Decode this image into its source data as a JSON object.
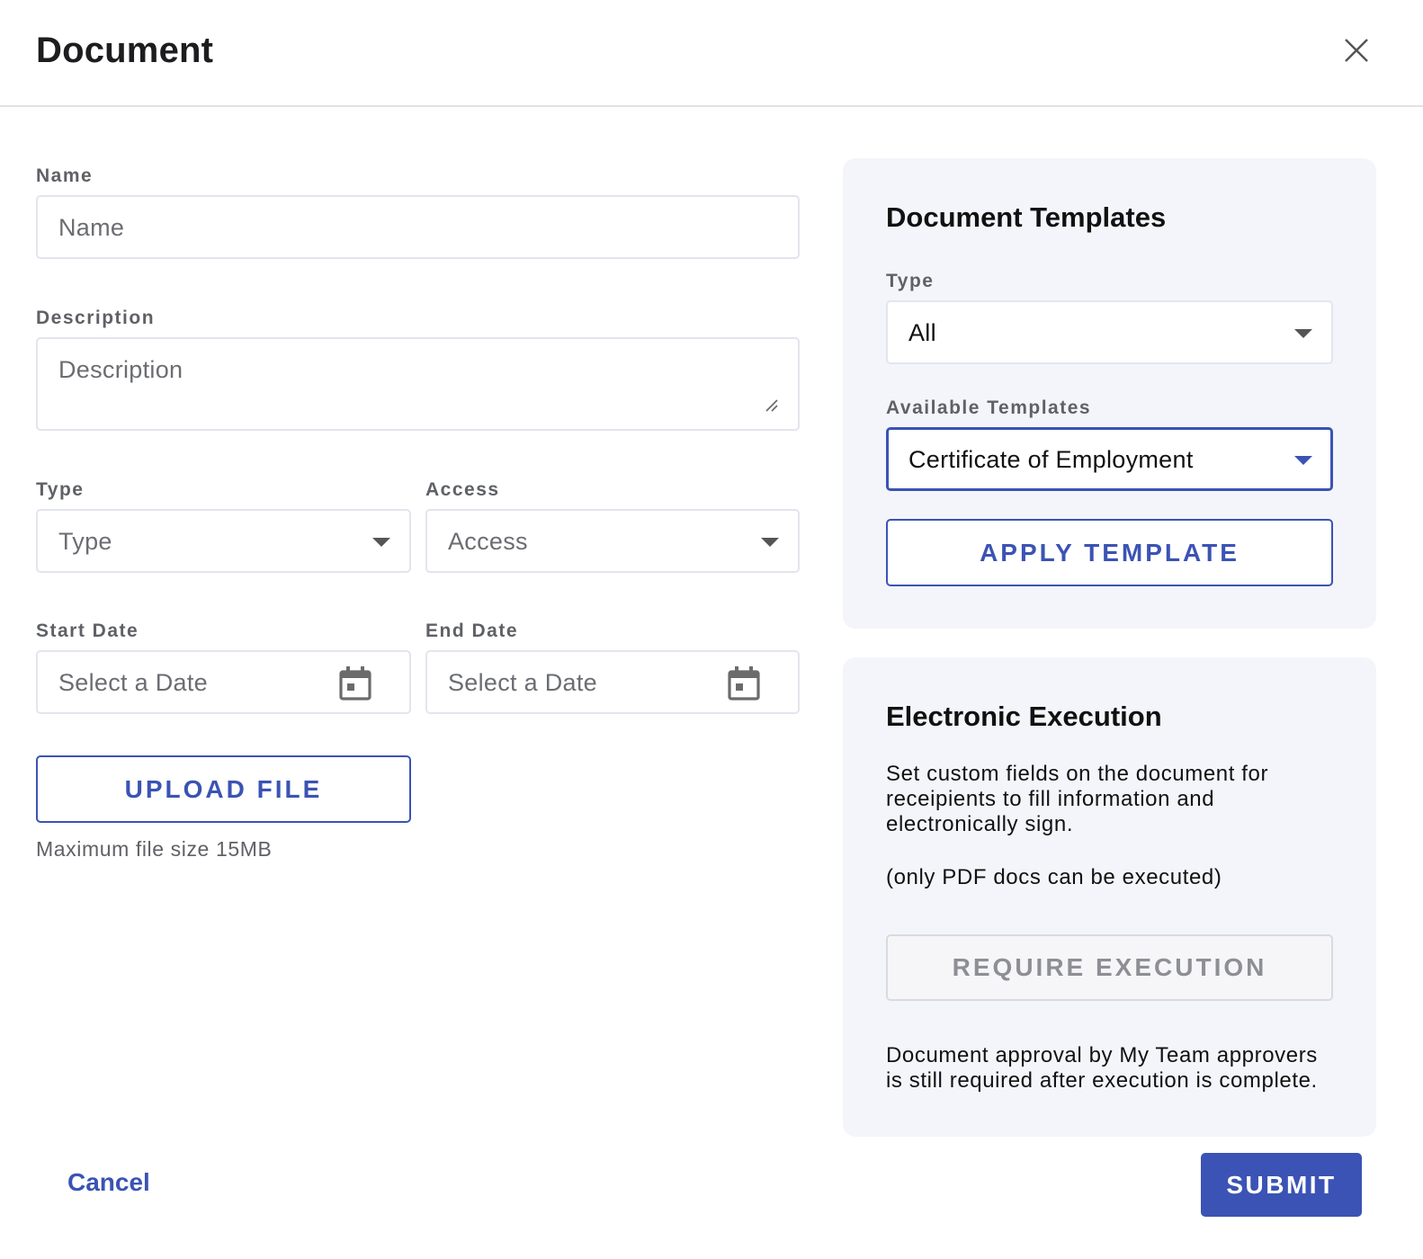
{
  "dialog": {
    "title": "Document"
  },
  "form": {
    "name": {
      "label": "Name",
      "placeholder": "Name"
    },
    "description": {
      "label": "Description",
      "placeholder": "Description"
    },
    "type": {
      "label": "Type",
      "placeholder": "Type"
    },
    "access": {
      "label": "Access",
      "placeholder": "Access"
    },
    "start_date": {
      "label": "Start Date",
      "placeholder": "Select a Date"
    },
    "end_date": {
      "label": "End Date",
      "placeholder": "Select a Date"
    },
    "upload": {
      "label": "UPLOAD FILE",
      "hint": "Maximum file size 15MB"
    }
  },
  "templates_panel": {
    "title": "Document Templates",
    "type": {
      "label": "Type",
      "value": "All"
    },
    "available": {
      "label": "Available Templates",
      "value": "Certificate of Employment"
    },
    "apply_label": "APPLY TEMPLATE"
  },
  "execution_panel": {
    "title": "Electronic Execution",
    "desc_lines": [
      "Set custom fields on the document for",
      "receipients to fill information and",
      "electronically sign."
    ],
    "note": "(only PDF docs can be executed)",
    "require_label": "REQUIRE EXECUTION",
    "approval_lines": [
      "Document approval by My Team approvers",
      "is still required after execution is complete."
    ]
  },
  "footer": {
    "cancel_label": "Cancel",
    "submit_label": "SUBMIT"
  },
  "colors": {
    "accent": "#3b53b4",
    "panel_bg": "#f4f5fa",
    "border": "#e3e5ee",
    "disabled": "#8e8f94"
  },
  "icons": {
    "close": "close-icon",
    "dropdown": "chevron-down-icon",
    "calendar": "calendar-icon",
    "resize": "resize-handle-icon"
  }
}
